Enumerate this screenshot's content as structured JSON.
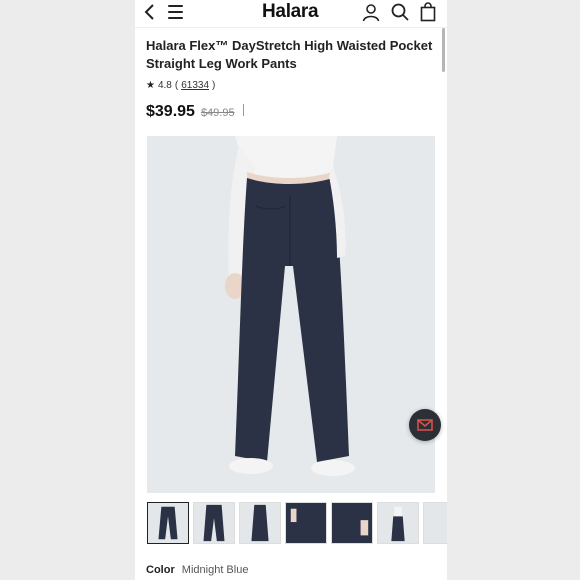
{
  "header": {
    "back_icon": "chevron-left-icon",
    "menu_icon": "hamburger-menu-icon",
    "logo": "Halara",
    "account_icon": "user-icon",
    "search_icon": "search-icon",
    "bag_icon": "shopping-bag-icon"
  },
  "product": {
    "title": "Halara Flex™ DayStretch High Waisted Pocket Straight Leg Work Pants",
    "rating": "4.8",
    "review_count": "61334",
    "price": "$39.95",
    "original_price": "$49.95",
    "color_label": "Color",
    "color_value": "Midnight Blue"
  },
  "gallery": {
    "main_image": "back view of model wearing navy wide leg pants and white top",
    "thumbnails": [
      "back view",
      "front view",
      "side view",
      "pocket detail",
      "fabric detail",
      "full outfit",
      "extra view"
    ],
    "selected_index": 0
  },
  "floating": {
    "mail_icon": "mail-icon"
  },
  "colors": {
    "accent": "#1a1a1a",
    "pants": "#2c3246",
    "background": "#e4e8ea"
  }
}
